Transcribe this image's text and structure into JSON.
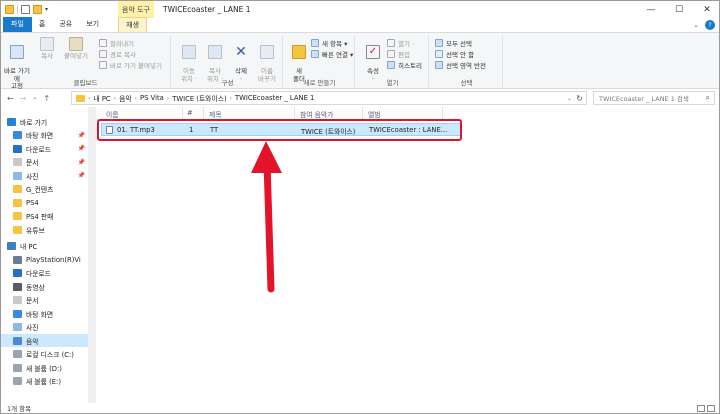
{
  "window": {
    "title": "TWICEcoaster _ LANE 1",
    "context_tab_group": "음악 도구",
    "controls": {
      "minimize": "—",
      "maximize": "☐",
      "close": "✕"
    }
  },
  "ribbon_tabs": {
    "file": "파일",
    "home": "홈",
    "share": "공유",
    "view": "보기",
    "play": "재생"
  },
  "ribbon": {
    "clipboard": {
      "label": "클립보드",
      "pin": "바로 가기에\n고정",
      "copy": "복사",
      "paste": "붙여넣기",
      "cut": "잘라내기",
      "copy_path": "경로 복사",
      "paste_shortcut": "바로 가기 붙여넣기"
    },
    "organize": {
      "label": "구성",
      "move_to": "이동\n위치 ·",
      "copy_to": "복사\n위치 ·",
      "delete": "삭제\n·",
      "rename": "이름\n바꾸기"
    },
    "new": {
      "label": "새로 만들기",
      "new_folder": "새\n폴더",
      "new_item": "새 항목 ▾",
      "easy_access": "빠른 연결 ▾"
    },
    "open": {
      "label": "열기",
      "properties": "속성\n·",
      "open": "열기 ·",
      "edit": "편집",
      "history": "히스토리"
    },
    "select": {
      "label": "선택",
      "select_all": "모두 선택",
      "select_none": "선택 안 함",
      "invert": "선택 영역 반전"
    }
  },
  "address": {
    "crumbs": [
      "내 PC",
      "음악",
      "PS Vita",
      "TWICE (트와이스)",
      "TWICEcoaster _ LANE 1"
    ],
    "search_placeholder": "TWICEcoaster _ LANE 1 검색"
  },
  "nav_pane": {
    "items": [
      {
        "label": "바로 가기",
        "icon": "star-icon",
        "pinned": false
      },
      {
        "label": "바탕 화면",
        "icon": "desktop-icon",
        "pinned": true
      },
      {
        "label": "다운로드",
        "icon": "download-icon",
        "pinned": true
      },
      {
        "label": "문서",
        "icon": "document-icon",
        "pinned": true
      },
      {
        "label": "사진",
        "icon": "picture-icon",
        "pinned": true
      },
      {
        "label": "G_컨텐츠",
        "icon": "folder-icon",
        "pinned": false
      },
      {
        "label": "PS4",
        "icon": "folder-icon",
        "pinned": false
      },
      {
        "label": "PS4 판매",
        "icon": "folder-icon",
        "pinned": false
      },
      {
        "label": "유튜브",
        "icon": "folder-icon",
        "pinned": false
      },
      {
        "label": "내 PC",
        "icon": "pc-icon",
        "pinned": false
      },
      {
        "label": "PlayStation(R)Vi",
        "icon": "device-icon",
        "pinned": false
      },
      {
        "label": "다운로드",
        "icon": "download-icon",
        "pinned": false
      },
      {
        "label": "동영상",
        "icon": "video-icon",
        "pinned": false
      },
      {
        "label": "문서",
        "icon": "document-icon",
        "pinned": false
      },
      {
        "label": "바탕 화면",
        "icon": "desktop-icon",
        "pinned": false
      },
      {
        "label": "사진",
        "icon": "picture-icon",
        "pinned": false
      },
      {
        "label": "음악",
        "icon": "music-icon",
        "pinned": false,
        "selected": true
      },
      {
        "label": "로컬 디스크 (C:)",
        "icon": "drive-icon",
        "pinned": false
      },
      {
        "label": "새 볼륨 (D:)",
        "icon": "drive-icon",
        "pinned": false
      },
      {
        "label": "새 볼륨 (E:)",
        "icon": "drive-icon",
        "pinned": false
      }
    ]
  },
  "file_list": {
    "columns": {
      "name": "이름",
      "number": "#",
      "title": "제목",
      "artist": "참여 음악가",
      "album": "앨범"
    },
    "rows": [
      {
        "name": "01. TT.mp3",
        "number": "1",
        "title": "TT",
        "artist": "TWICE (트와이스)",
        "album": "TWICEcoaster : LANE..."
      }
    ]
  },
  "status_bar": {
    "count": "1개 항목"
  },
  "colors": {
    "accent": "#1979ca",
    "selection": "#cce8ff",
    "annotation": "#e3132a"
  }
}
